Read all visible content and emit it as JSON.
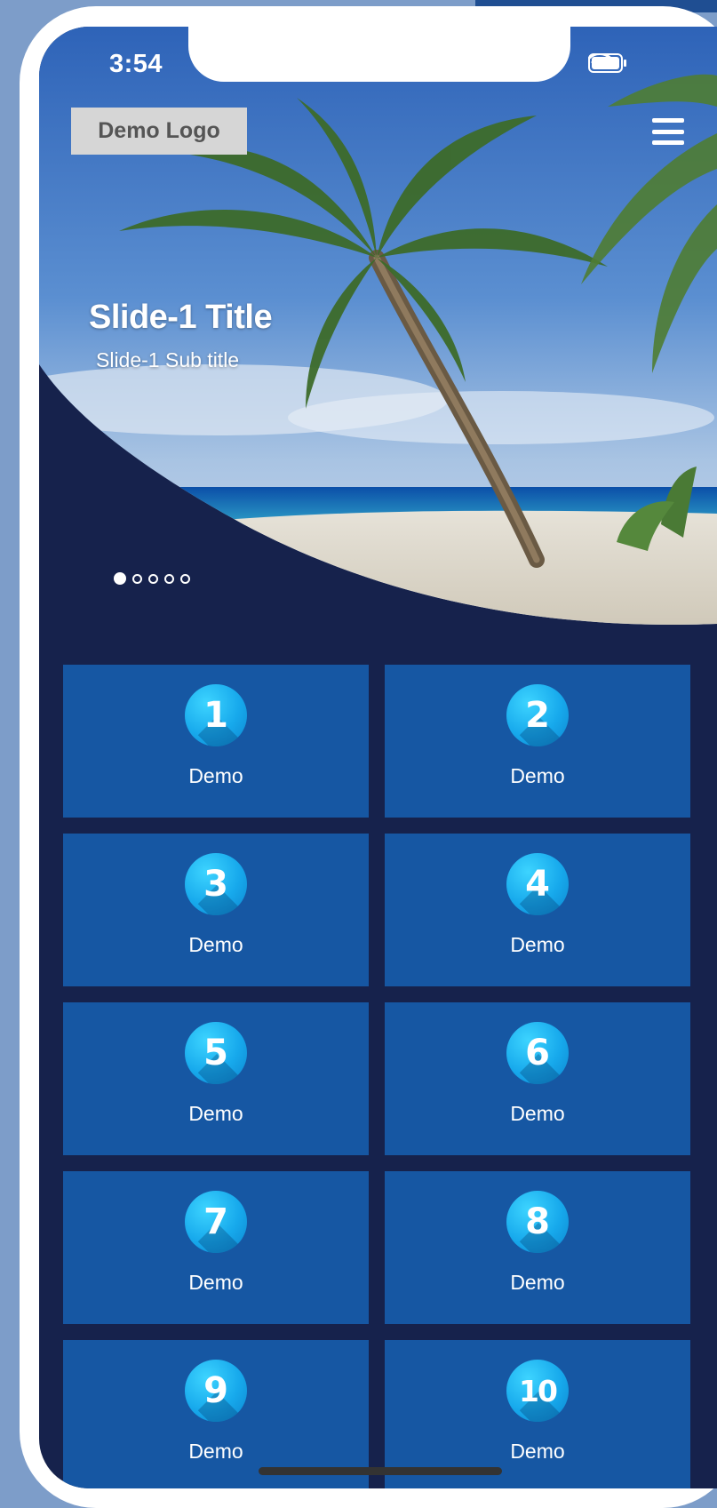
{
  "status_bar": {
    "time": "3:54"
  },
  "header": {
    "logo_text": "Demo Logo",
    "menu_icon": "hamburger-menu-icon"
  },
  "slider": {
    "title": "Slide-1 Title",
    "subtitle": "Slide-1 Sub title",
    "total_slides": 5,
    "active_index": 0
  },
  "tiles": [
    {
      "number": "1",
      "label": "Demo"
    },
    {
      "number": "2",
      "label": "Demo"
    },
    {
      "number": "3",
      "label": "Demo"
    },
    {
      "number": "4",
      "label": "Demo"
    },
    {
      "number": "5",
      "label": "Demo"
    },
    {
      "number": "6",
      "label": "Demo"
    },
    {
      "number": "7",
      "label": "Demo"
    },
    {
      "number": "8",
      "label": "Demo"
    },
    {
      "number": "9",
      "label": "Demo"
    },
    {
      "number": "10",
      "label": "Demo"
    }
  ],
  "colors": {
    "page_background": "#7d9dc9",
    "screen_background": "#16224c",
    "tile_background": "#1657a3",
    "badge_accent": "#17a9ec"
  }
}
